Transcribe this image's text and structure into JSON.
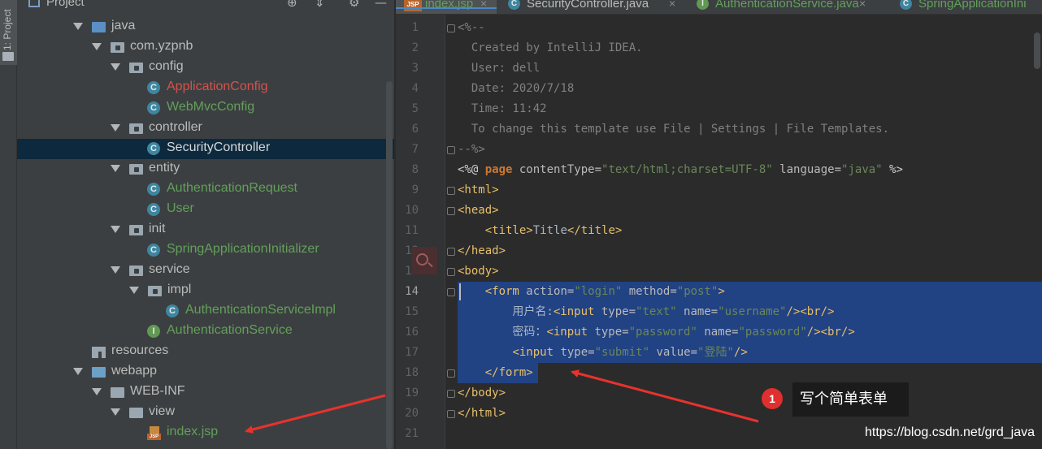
{
  "toolstrip": {
    "label": "1: Project"
  },
  "project_panel": {
    "title": "Project",
    "icons": [
      "locate-icon",
      "collapse-icon",
      "settings-icon",
      "hide-icon"
    ]
  },
  "tree": [
    {
      "label": "java",
      "kind": "source-folder",
      "expanded": true,
      "color": "default"
    },
    {
      "label": "com.yzpnb",
      "kind": "package",
      "expanded": true,
      "color": "default"
    },
    {
      "label": "config",
      "kind": "package",
      "expanded": true,
      "color": "default"
    },
    {
      "label": "ApplicationConfig",
      "kind": "class",
      "color": "red"
    },
    {
      "label": "WebMvcConfig",
      "kind": "class",
      "color": "green"
    },
    {
      "label": "controller",
      "kind": "package",
      "expanded": true,
      "color": "default"
    },
    {
      "label": "SecurityController",
      "kind": "class",
      "color": "white",
      "selected": true
    },
    {
      "label": "entity",
      "kind": "package",
      "expanded": true,
      "color": "default"
    },
    {
      "label": "AuthenticationRequest",
      "kind": "class",
      "color": "green"
    },
    {
      "label": "User",
      "kind": "class",
      "color": "green"
    },
    {
      "label": "init",
      "kind": "package",
      "expanded": true,
      "color": "default"
    },
    {
      "label": "SpringApplicationInitializer",
      "kind": "class",
      "color": "green"
    },
    {
      "label": "service",
      "kind": "package",
      "expanded": true,
      "color": "default"
    },
    {
      "label": "impl",
      "kind": "package",
      "expanded": true,
      "color": "default"
    },
    {
      "label": "AuthenticationServiceImpl",
      "kind": "class",
      "color": "green"
    },
    {
      "label": "AuthenticationService",
      "kind": "interface",
      "color": "green"
    },
    {
      "label": "resources",
      "kind": "resources",
      "color": "default"
    },
    {
      "label": "webapp",
      "kind": "web-folder",
      "expanded": true,
      "color": "default"
    },
    {
      "label": "WEB-INF",
      "kind": "folder",
      "expanded": true,
      "color": "default"
    },
    {
      "label": "view",
      "kind": "folder",
      "expanded": true,
      "color": "default"
    },
    {
      "label": "index.jsp",
      "kind": "jsp",
      "color": "green"
    }
  ],
  "tabs": [
    {
      "label": "index.jsp",
      "icon": "jsp-file-icon",
      "active": true,
      "color": "#62a05a"
    },
    {
      "label": "SecurityController.java",
      "icon": "class-icon",
      "color": "#bbbbbb"
    },
    {
      "label": "AuthenticationService.java",
      "icon": "interface-icon",
      "color": "#62a05a"
    },
    {
      "label": "SpringApplicationIni",
      "icon": "class-icon",
      "color": "#62a05a"
    }
  ],
  "editor": {
    "current_line": 14,
    "line_numbers": [
      "1",
      "2",
      "3",
      "4",
      "5",
      "6",
      "7",
      "8",
      "9",
      "10",
      "11",
      "12",
      "13",
      "14",
      "15",
      "16",
      "17",
      "18",
      "19",
      "20",
      "21"
    ],
    "lines": [
      [
        [
          "cm",
          "<%--"
        ]
      ],
      [
        [
          "cm",
          "  Created by IntelliJ IDEA."
        ]
      ],
      [
        [
          "cm",
          "  User: dell"
        ]
      ],
      [
        [
          "cm",
          "  Date: 2020/7/18"
        ]
      ],
      [
        [
          "cm",
          "  Time: 11:42"
        ]
      ],
      [
        [
          "cm",
          "  To change this template use File | Settings | File Templates."
        ]
      ],
      [
        [
          "cm",
          "--%>"
        ]
      ],
      [
        [
          "white",
          "<%@ "
        ],
        [
          "kw",
          "page"
        ],
        [
          "attr",
          " contentType="
        ],
        [
          "val",
          "\"text/html;charset=UTF-8\""
        ],
        [
          "attr",
          " language="
        ],
        [
          "val",
          "\"java\""
        ],
        [
          "white",
          " %>"
        ]
      ],
      [
        [
          "tag",
          "<html>"
        ]
      ],
      [
        [
          "tag",
          "<head>"
        ]
      ],
      [
        [
          "txt",
          "    "
        ],
        [
          "tag",
          "<title>"
        ],
        [
          "txt",
          "Title"
        ],
        [
          "tag",
          "</title>"
        ]
      ],
      [
        [
          "tag",
          "</head>"
        ]
      ],
      [
        [
          "tag",
          "<body>"
        ]
      ],
      [
        [
          "txt",
          "    "
        ],
        [
          "tag",
          "<form"
        ],
        [
          "attr",
          " action="
        ],
        [
          "val",
          "\"login\""
        ],
        [
          "attr",
          " method="
        ],
        [
          "val",
          "\"post\""
        ],
        [
          "tag",
          ">"
        ]
      ],
      [
        [
          "txt",
          "        用户名:"
        ],
        [
          "tag",
          "<input"
        ],
        [
          "attr",
          " type="
        ],
        [
          "val",
          "\"text\""
        ],
        [
          "attr",
          " name="
        ],
        [
          "val",
          "\"username\""
        ],
        [
          "tag",
          "/><br/>"
        ]
      ],
      [
        [
          "txt",
          "        密码："
        ],
        [
          "tag",
          "<input"
        ],
        [
          "attr",
          " type="
        ],
        [
          "val",
          "\"password\""
        ],
        [
          "attr",
          " name="
        ],
        [
          "val",
          "\"password\""
        ],
        [
          "tag",
          "/><br/>"
        ]
      ],
      [
        [
          "txt",
          "        "
        ],
        [
          "tag",
          "<input"
        ],
        [
          "attr",
          " type="
        ],
        [
          "val",
          "\"submit\""
        ],
        [
          "attr",
          " value="
        ],
        [
          "val",
          "\"登陆\""
        ],
        [
          "tag",
          "/>"
        ]
      ],
      [
        [
          "txt",
          "    "
        ],
        [
          "tag",
          "</form>"
        ]
      ],
      [
        [
          "tag",
          "</body>"
        ]
      ],
      [
        [
          "tag",
          "</html>"
        ]
      ],
      []
    ]
  },
  "annotation": {
    "badge": "1",
    "note": "写个简单表单"
  },
  "watermark": "https://blog.csdn.net/grd_java",
  "colors": {
    "panel_bg": "#3c3f41",
    "editor_bg": "#2b2b2b",
    "selection": "#214283",
    "tree_selected": "#0d293e",
    "annotation_red": "#e02f2f"
  }
}
